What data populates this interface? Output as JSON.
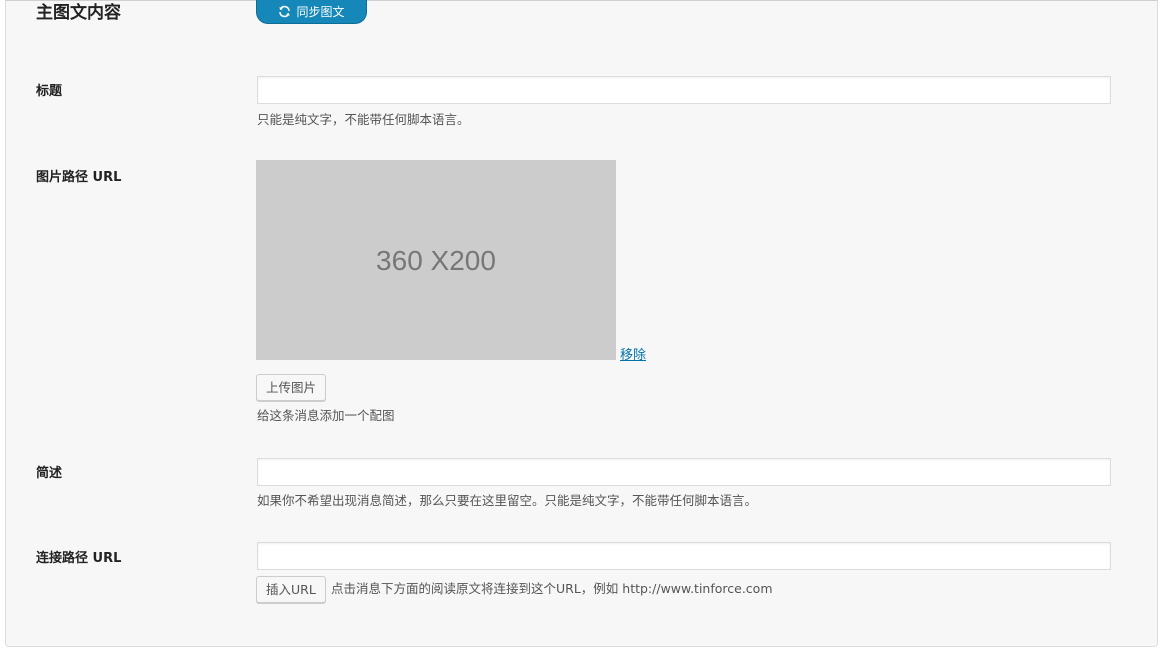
{
  "section": {
    "title": "主图文内容",
    "sync_button_label": "同步图文"
  },
  "fields": {
    "title": {
      "label": "标题",
      "value": "",
      "description": "只能是纯文字，不能带任何脚本语言。"
    },
    "image": {
      "label": "图片路径 URL",
      "placeholder_text": "360 X200",
      "remove_label": "移除",
      "upload_button_label": "上传图片",
      "description": "给这条消息添加一个配图"
    },
    "summary": {
      "label": "简述",
      "value": "",
      "description": "如果你不希望出现消息简述，那么只要在这里留空。只能是纯文字，不能带任何脚本语言。"
    },
    "link": {
      "label": "连接路径 URL",
      "value": "",
      "insert_button_label": "插入URL",
      "description": "点击消息下方面的阅读原文将连接到这个URL，例如 http://www.tinforce.com"
    }
  },
  "colors": {
    "accent": "#1587b8",
    "link": "#0073aa",
    "panel_bg": "#f7f7f7",
    "image_placeholder_bg": "#cccccc"
  },
  "icons": {
    "sync": "refresh-icon"
  }
}
